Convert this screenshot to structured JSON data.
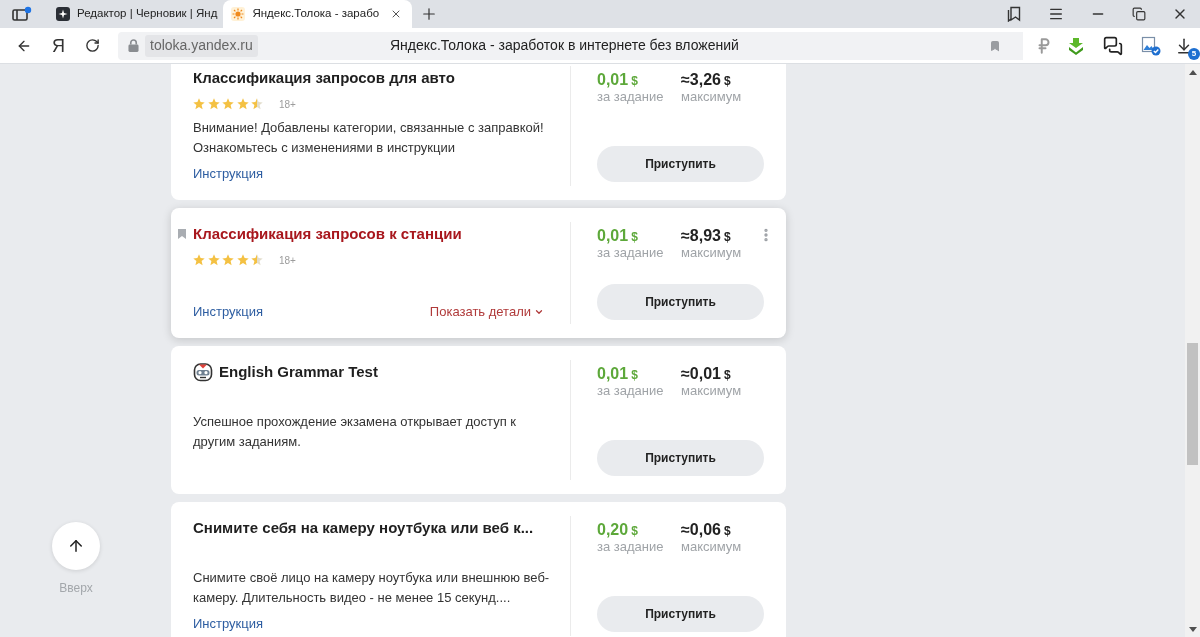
{
  "browser": {
    "tabs": [
      {
        "title": "Редактор | Черновик | Янд",
        "selected": false
      },
      {
        "title": "Яндекс.Толока - зарабо",
        "selected": true
      }
    ],
    "home_button": "Я",
    "address": {
      "url": "toloka.yandex.ru",
      "page_title": "Яндекс.Толока - заработок в интернете без вложений"
    },
    "downloads_badge": "5"
  },
  "tasks": [
    {
      "kind": "task",
      "title": "Классификация запросов для авто",
      "highlighted": false,
      "stars": 4.5,
      "age": "18+",
      "description": "Внимание! Добавлены категории, связанные с заправкой! Ознакомьтесь с изменениями в инструкции",
      "instruction_link": "Инструкция",
      "reward": {
        "amount": "0,01",
        "currency": "$",
        "label": "за задание"
      },
      "maximum": {
        "amount": "≈3,26",
        "currency": "$",
        "label": "максимум"
      },
      "button": "Приступить"
    },
    {
      "kind": "task",
      "title": "Классификация запросов к станции",
      "highlighted": true,
      "stars": 4.5,
      "age": "18+",
      "instruction_link": "Инструкция",
      "details_link": "Показать детали",
      "reward": {
        "amount": "0,01",
        "currency": "$",
        "label": "за задание"
      },
      "maximum": {
        "amount": "≈8,93",
        "currency": "$",
        "label": "максимум"
      },
      "button": "Приступить"
    },
    {
      "kind": "exam",
      "title": "English Grammar Test",
      "highlighted": false,
      "description": "Успешное прохождение экзамена открывает доступ к другим заданиям.",
      "reward": {
        "amount": "0,01",
        "currency": "$",
        "label": "за задание"
      },
      "maximum": {
        "amount": "≈0,01",
        "currency": "$",
        "label": "максимум"
      },
      "button": "Приступить"
    },
    {
      "kind": "task",
      "title": "Снимите себя на камеру ноутбука или веб к...",
      "highlighted": false,
      "description": "Снимите своё лицо на камеру ноутбука или внешнюю веб-камеру. Длительность видео - не менее 15 секунд....",
      "instruction_link": "Инструкция",
      "reward": {
        "amount": "0,20",
        "currency": "$",
        "label": "за задание"
      },
      "maximum": {
        "amount": "≈0,06",
        "currency": "$",
        "label": "максимум"
      },
      "button": "Приступить"
    }
  ],
  "scroll_top": {
    "label": "Вверх"
  }
}
